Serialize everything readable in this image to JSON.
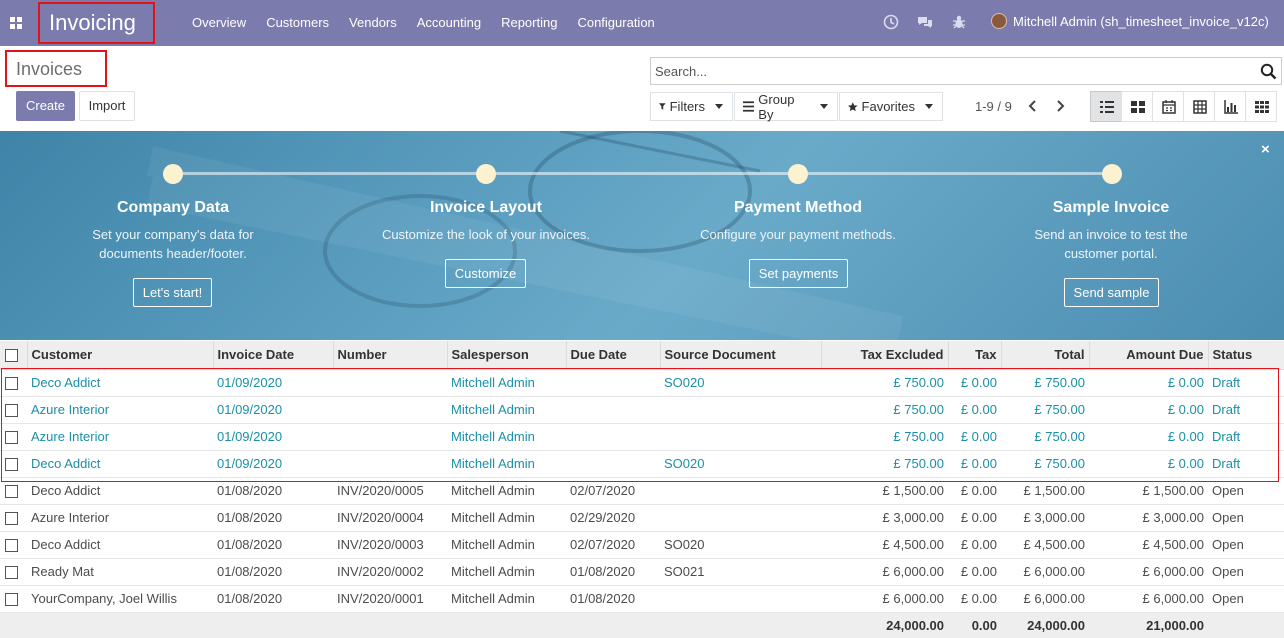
{
  "navbar": {
    "app_name": "Invoicing",
    "menu": [
      "Overview",
      "Customers",
      "Vendors",
      "Accounting",
      "Reporting",
      "Configuration"
    ],
    "user": "Mitchell Admin (sh_timesheet_invoice_v12c)",
    "bg_color": "#7c7bad"
  },
  "control_panel": {
    "title": "Invoices",
    "create_label": "Create",
    "import_label": "Import",
    "search_placeholder": "Search...",
    "filters_label": "Filters",
    "groupby_label": "Group By",
    "favorites_label": "Favorites",
    "pager": "1-9 / 9",
    "views": [
      "list-view-icon",
      "kanban-view-icon",
      "calendar-view-icon",
      "pivot-view-icon",
      "graph-view-icon",
      "grid-view-icon"
    ]
  },
  "banner": {
    "steps": [
      {
        "title": "Company Data",
        "desc": "Set your company's data for documents header/footer.",
        "button": "Let's start!"
      },
      {
        "title": "Invoice Layout",
        "desc": "Customize the look of your invoices.",
        "button": "Customize"
      },
      {
        "title": "Payment Method",
        "desc": "Configure your payment methods.",
        "button": "Set payments"
      },
      {
        "title": "Sample Invoice",
        "desc": "Send an invoice to test the customer portal.",
        "button": "Send sample"
      }
    ],
    "close": "×"
  },
  "table": {
    "columns": [
      "Customer",
      "Invoice Date",
      "Number",
      "Salesperson",
      "Due Date",
      "Source Document",
      "Tax Excluded",
      "Tax",
      "Total",
      "Amount Due",
      "Status"
    ],
    "rows": [
      {
        "customer": "Deco Addict",
        "date": "01/09/2020",
        "number": "",
        "salesperson": "Mitchell Admin",
        "due": "",
        "source": "SO020",
        "tax_excl": "£ 750.00",
        "tax": "£ 0.00",
        "total": "£ 750.00",
        "due_amt": "£ 0.00",
        "status": "Draft"
      },
      {
        "customer": "Azure Interior",
        "date": "01/09/2020",
        "number": "",
        "salesperson": "Mitchell Admin",
        "due": "",
        "source": "",
        "tax_excl": "£ 750.00",
        "tax": "£ 0.00",
        "total": "£ 750.00",
        "due_amt": "£ 0.00",
        "status": "Draft"
      },
      {
        "customer": "Azure Interior",
        "date": "01/09/2020",
        "number": "",
        "salesperson": "Mitchell Admin",
        "due": "",
        "source": "",
        "tax_excl": "£ 750.00",
        "tax": "£ 0.00",
        "total": "£ 750.00",
        "due_amt": "£ 0.00",
        "status": "Draft"
      },
      {
        "customer": "Deco Addict",
        "date": "01/09/2020",
        "number": "",
        "salesperson": "Mitchell Admin",
        "due": "",
        "source": "SO020",
        "tax_excl": "£ 750.00",
        "tax": "£ 0.00",
        "total": "£ 750.00",
        "due_amt": "£ 0.00",
        "status": "Draft"
      },
      {
        "customer": "Deco Addict",
        "date": "01/08/2020",
        "number": "INV/2020/0005",
        "salesperson": "Mitchell Admin",
        "due": "02/07/2020",
        "source": "",
        "tax_excl": "£ 1,500.00",
        "tax": "£ 0.00",
        "total": "£ 1,500.00",
        "due_amt": "£ 1,500.00",
        "status": "Open"
      },
      {
        "customer": "Azure Interior",
        "date": "01/08/2020",
        "number": "INV/2020/0004",
        "salesperson": "Mitchell Admin",
        "due": "02/29/2020",
        "source": "",
        "tax_excl": "£ 3,000.00",
        "tax": "£ 0.00",
        "total": "£ 3,000.00",
        "due_amt": "£ 3,000.00",
        "status": "Open"
      },
      {
        "customer": "Deco Addict",
        "date": "01/08/2020",
        "number": "INV/2020/0003",
        "salesperson": "Mitchell Admin",
        "due": "02/07/2020",
        "source": "SO020",
        "tax_excl": "£ 4,500.00",
        "tax": "£ 0.00",
        "total": "£ 4,500.00",
        "due_amt": "£ 4,500.00",
        "status": "Open"
      },
      {
        "customer": "Ready Mat",
        "date": "01/08/2020",
        "number": "INV/2020/0002",
        "salesperson": "Mitchell Admin",
        "due": "01/08/2020",
        "source": "SO021",
        "tax_excl": "£ 6,000.00",
        "tax": "£ 0.00",
        "total": "£ 6,000.00",
        "due_amt": "£ 6,000.00",
        "status": "Open"
      },
      {
        "customer": "YourCompany, Joel Willis",
        "date": "01/08/2020",
        "number": "INV/2020/0001",
        "salesperson": "Mitchell Admin",
        "due": "01/08/2020",
        "source": "",
        "tax_excl": "£ 6,000.00",
        "tax": "£ 0.00",
        "total": "£ 6,000.00",
        "due_amt": "£ 6,000.00",
        "status": "Open"
      }
    ],
    "totals": {
      "tax_excl": "24,000.00",
      "tax": "0.00",
      "total": "24,000.00",
      "due_amt": "21,000.00"
    },
    "draft_color": "#1a8fa8"
  }
}
